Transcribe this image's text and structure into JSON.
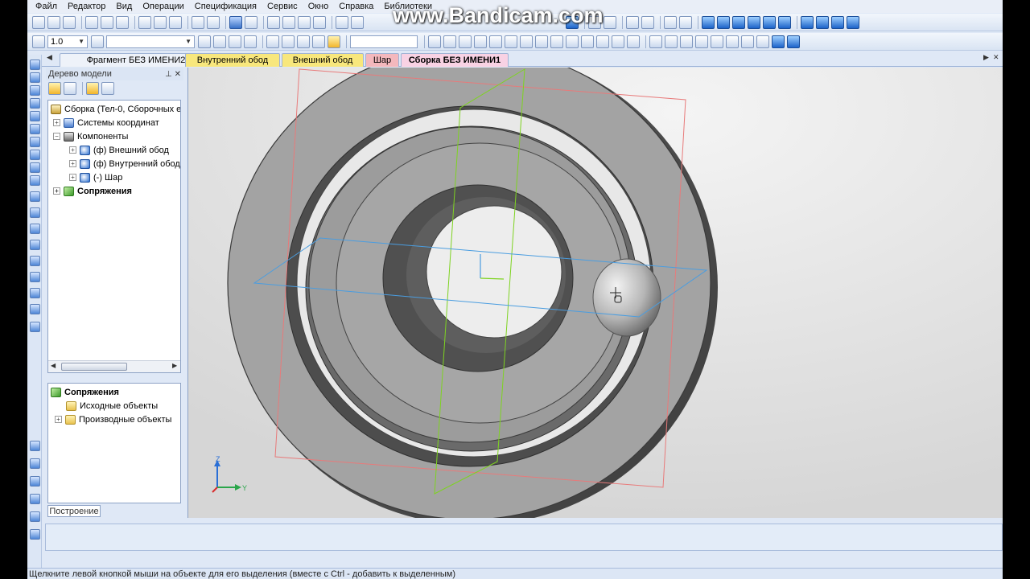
{
  "watermark": "www.Bandicam.com",
  "menu": [
    "Файл",
    "Редактор",
    "Вид",
    "Операции",
    "Спецификация",
    "Сервис",
    "Окно",
    "Справка",
    "Библиотеки"
  ],
  "toolbar2": {
    "scale_value": "1.0",
    "style_value": ""
  },
  "doc_tabs": [
    {
      "label": "Фрагмент БЕЗ ИМЕНИ2",
      "color": "#eef2f9"
    },
    {
      "label": "Внутренний обод",
      "color": "#f8e77c"
    },
    {
      "label": "Внешний обод",
      "color": "#f8e77c"
    },
    {
      "label": "Шар",
      "color": "#f4b8bd"
    },
    {
      "label": "Сборка БЕЗ ИМЕНИ1",
      "color": "#f9d2e4",
      "active": true
    }
  ],
  "tree_panel": {
    "title": "Дерево модели",
    "items": [
      {
        "label": "Сборка (Тел-0, Сборочных е",
        "icon": "assembly-icon"
      },
      {
        "label": "Системы координат",
        "icon": "coordinate-systems-icon"
      },
      {
        "label": "Компоненты",
        "icon": "components-icon"
      },
      {
        "label": "(ф) Внешний обод",
        "icon": "part-icon"
      },
      {
        "label": "(ф) Внутренний обод",
        "icon": "part-icon"
      },
      {
        "label": "(-) Шар",
        "icon": "part-icon"
      },
      {
        "label": "Сопряжения",
        "icon": "mates-icon",
        "bold": true
      }
    ]
  },
  "lower_panel": {
    "items": [
      {
        "label": "Сопряжения",
        "icon": "mates-icon",
        "bold": true
      },
      {
        "label": "Исходные объекты",
        "icon": "folder-icon"
      },
      {
        "label": "Производные объекты",
        "icon": "folder-icon"
      }
    ]
  },
  "panel_tab": "Построение",
  "axes": {
    "z": "Z",
    "y": "Y"
  },
  "status": "Щелкните левой кнопкой мыши на объекте для его выделения (вместе с Ctrl - добавить к выделенным)",
  "colors": {
    "accent": "#3a72c9",
    "plane_green": "#7ed321",
    "plane_red": "#e87a7a",
    "plane_blue": "#4a9de0",
    "part_grey": "#9a9a9a"
  }
}
